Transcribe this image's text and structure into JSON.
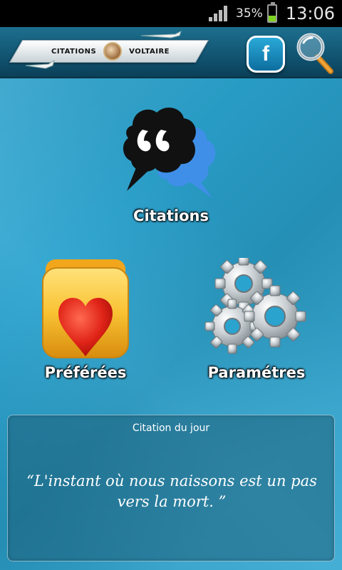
{
  "status_bar": {
    "battery_percent": "35%",
    "time": "13:06",
    "battery_level": 0.35
  },
  "header": {
    "logo_left_text": "CITATIONS",
    "logo_right_text": "VOLTAIRE",
    "facebook_label": "f",
    "icons": [
      "facebook-icon",
      "magnifier-icon"
    ]
  },
  "menu": {
    "citations_label": "Citations",
    "favorites_label": "Préférées",
    "settings_label": "Paramétres"
  },
  "quote_of_day": {
    "title": "Citation du jour",
    "text": "“L'instant où nous naissons est un pas vers la mort. ”"
  },
  "colors": {
    "background": "#2aa3cf",
    "header": "#0f4f6b",
    "speech_bubble_black": "#111111",
    "speech_bubble_blue": "#3f8fe8",
    "heart": "#e02418",
    "folder": "#f6b61c"
  }
}
